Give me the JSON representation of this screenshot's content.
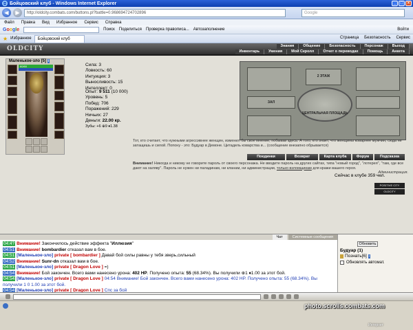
{
  "window": {
    "title": "Бойцовский клуб - Windows Internet Explorer"
  },
  "address": {
    "url": "http://oldcity.combats.com/buttons.pl?battle=0.968694724702896",
    "search_placeholder": "Google"
  },
  "menu": [
    "Файл",
    "Правка",
    "Вид",
    "Избранное",
    "Сервис",
    "Справка"
  ],
  "gtoolbar": {
    "search_label": "Поиск",
    "share": "Поделиться",
    "spell": "Проверка правописа...",
    "autofill": "Автозаполнение",
    "login": "Войти"
  },
  "tabbar": {
    "favorites": "Избранное",
    "tab_title": "Бойцовский клуб",
    "page": "Страница",
    "security": "Безопасность",
    "service": "Сервис"
  },
  "game": {
    "logo": "OLDCITY",
    "topnav_row1": [
      "Знания",
      "Общение",
      "Безопасность",
      "Персонаж",
      "Выход"
    ],
    "topnav_row2": [
      "Инвентарь",
      "Умения",
      "Мой Скролл",
      "Отчет о переводах",
      "Помощь",
      "Анкета"
    ],
    "character": {
      "name": "Маленькое-зло",
      "level": "[5]",
      "hp": "60/60"
    },
    "stats": [
      "Сила: 3",
      "Ловкость: 60",
      "Интуиция: 3",
      "Выносливость: 15",
      "Интеллект: 0"
    ],
    "stats2": [
      {
        "label": "Опыт: ",
        "value": "9 511",
        "extra": " (10 000)"
      },
      {
        "label": "Уровень: ",
        "value": "5"
      },
      {
        "label": "Побед: ",
        "value": "706"
      },
      {
        "label": "Поражений: ",
        "value": "229"
      },
      {
        "label": "Ничьих: ",
        "value": "27"
      },
      {
        "label": "Деньги: ",
        "value": "22.00 кр."
      },
      {
        "label": "Зубы: ",
        "value": "+6 ⊕9 ♦1.38"
      }
    ],
    "map": {
      "floor": "2 ЭТАЖ",
      "hall": "ЗАЛ",
      "square": "ЦЕНТРАЛЬНАЯ ПЛОЩАДЬ"
    },
    "quote": "Тот, кто считает, что нужными агрессивнее женщин, изменил бы свое мнение, побывав здесь. А того, кто знает, что женщины коварнее мужчин, сюда не затащишь и силой. Попону - это: Будуар в Демоне. Цитадель коварства и... (сообщение внезапно обрывается)",
    "buttons": [
      "Поединки",
      "Возврат",
      "Карта клуба",
      "Форум",
      "Подсказка"
    ],
    "warning_label": "Внимание!",
    "warning": " Никогда и никому не говорите пароль от своего персонажа. Не вводите пароль на других сайтах, типа \"новый город\", \"лотерея\", \"там, где все дают на халяву\". Пароль не нужен ни паладинам, ни кланам, ни администрации,",
    "warning_link": "только взломщикам",
    "warning_end": " для кражи вашего героя.",
    "admin": "Администрация.",
    "online": "Сейчас в клубе 359 чел.",
    "banners": [
      "POSITIVE CITY NETWORK",
      "OLDCITY"
    ]
  },
  "chat": {
    "tabs": [
      "Чат",
      "Системные сообщения"
    ],
    "lines": [
      {
        "time": "04:4?",
        "parts": [
          {
            "c": "red",
            "t": "Внимание!"
          },
          {
            "c": "",
            "t": " Закончилось действие эффекта \""
          },
          {
            "c": "b",
            "t": "Иллюзия"
          },
          {
            "c": "",
            "t": "\""
          }
        ]
      },
      {
        "time": "04:51",
        "parts": [
          {
            "c": "red",
            "t": "Внимание!"
          },
          {
            "c": "",
            "t": " "
          },
          {
            "c": "b",
            "t": "bombardier"
          },
          {
            "c": "",
            "t": " отказал вам в бое."
          }
        ]
      },
      {
        "time": "04:51",
        "parts": [
          {
            "c": "dblue",
            "t": "[Маленькое-зло]"
          },
          {
            "c": "red",
            "t": " private [ bombardier ]"
          },
          {
            "c": "",
            "t": " Давай бой силы равны у тебя зверь,сильный"
          }
        ]
      },
      {
        "time": "04:52",
        "parts": [
          {
            "c": "red",
            "t": "Внимание!"
          },
          {
            "c": "",
            "t": " "
          },
          {
            "c": "b",
            "t": "Sunr-dn"
          },
          {
            "c": "",
            "t": " отказал вам в бое."
          }
        ]
      },
      {
        "time": "04:51",
        "parts": [
          {
            "c": "dblue",
            "t": "[Маленькое-зло]"
          },
          {
            "c": "red",
            "t": " private [ Dragon Love ]"
          },
          {
            "c": "",
            "t": " =)"
          }
        ]
      },
      {
        "time": "04:54",
        "parts": [
          {
            "c": "red",
            "t": "Внимание!"
          },
          {
            "c": "",
            "t": " Бой закончен. Всего вами нанесено урона: "
          },
          {
            "c": "b",
            "t": "402 HP"
          },
          {
            "c": "",
            "t": ". Получено опыта: "
          },
          {
            "c": "b",
            "t": "55"
          },
          {
            "c": "",
            "t": " (68.34%). Вы получили ⊕1 ♦1.00 за этот бой."
          }
        ]
      },
      {
        "time": "04:54",
        "parts": [
          {
            "c": "dblue",
            "t": "[Маленькое-зло]"
          },
          {
            "c": "red",
            "t": " private [ Dragon Love ]"
          },
          {
            "c": "blue",
            "t": " 04:54 Внимание! Бой закончен. Всего вами нанесено урона: 402 HP. Получено опыта: 55 (68.34%). Вы получили 1 0 1.00 за этот бой."
          }
        ]
      },
      {
        "time": "04:54",
        "parts": [
          {
            "c": "dblue",
            "t": "[Маленькое-зло]"
          },
          {
            "c": "red",
            "t": " private [ Dragon Love ]"
          },
          {
            "c": "blue",
            "t": " Спс за бой"
          }
        ]
      }
    ]
  },
  "rightpanel": {
    "refresh": "Обновить",
    "room": "Будуар (1)",
    "user": "Познать[6]",
    "auto": "Обновлять автомат."
  },
  "watermark": {
    "main": "photo.scrolls.combats.com",
    "sub": "Интернет"
  }
}
